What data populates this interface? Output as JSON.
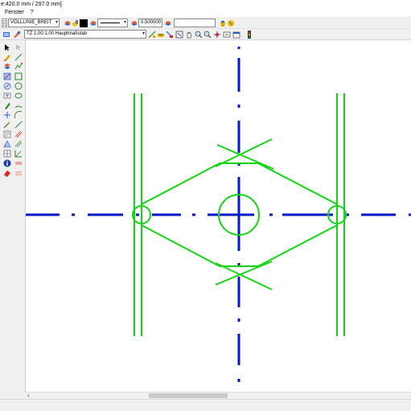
{
  "window": {
    "title": "e:420.0 mm / 297.0 mm]"
  },
  "menu": {
    "items": [
      "Fenster",
      "?"
    ]
  },
  "toolbar1": {
    "line_type": "VOLLLINIE_BREIT",
    "line_style_value": "",
    "pen_width": "0.500000",
    "extra_field": ""
  },
  "toolbar2": {
    "scale_label": "TZ 1.00:1.00 Hauptmaßstab"
  },
  "colors": {
    "axis_blue": "#0018c8",
    "geometry_green": "#12d612"
  }
}
